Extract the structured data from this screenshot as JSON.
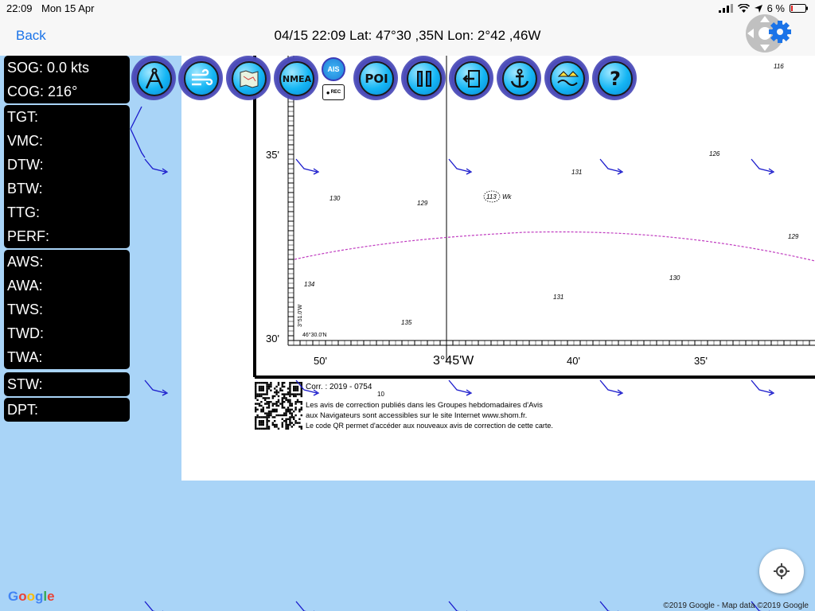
{
  "status_bar": {
    "time": "22:09",
    "date": "Mon 15 Apr",
    "battery": "6 %"
  },
  "nav": {
    "back_label": "Back",
    "title": "04/15 22:09  Lat: 47°30 ,35N Lon: 2°42 ,46W"
  },
  "panels": {
    "nav_group": [
      {
        "label": "SOG:",
        "value": "0.0 kts"
      },
      {
        "label": "COG:",
        "value": "216°"
      }
    ],
    "route_group": [
      {
        "label": "TGT:",
        "value": ""
      },
      {
        "label": "VMC:",
        "value": ""
      },
      {
        "label": "DTW:",
        "value": ""
      },
      {
        "label": "BTW:",
        "value": ""
      },
      {
        "label": "TTG:",
        "value": ""
      },
      {
        "label": "PERF:",
        "value": ""
      }
    ],
    "wind_group": [
      {
        "label": "AWS:",
        "value": ""
      },
      {
        "label": "AWA:",
        "value": ""
      },
      {
        "label": "TWS:",
        "value": ""
      },
      {
        "label": "TWD:",
        "value": ""
      },
      {
        "label": "TWA:",
        "value": ""
      }
    ],
    "stw_group": [
      {
        "label": "STW:",
        "value": ""
      }
    ],
    "dpt_group": [
      {
        "label": "DPT:",
        "value": ""
      }
    ]
  },
  "toolbar": {
    "nmea_label": "NMEA",
    "ais_label": "AIS",
    "rec_label": "REC",
    "poi_label": "POI",
    "help_label": "?"
  },
  "chart": {
    "lat_labels": {
      "top": "35'",
      "bottom": "30'"
    },
    "lon_labels": {
      "a": "50'",
      "b": "3°45'W",
      "c": "40'",
      "d": "35'"
    },
    "side_label": "3°51.0'W",
    "corner_label": "46°30.0'N",
    "soundings": [
      "116",
      "126",
      "131",
      "130",
      "129",
      "113",
      "Wk",
      "129",
      "134",
      "130",
      "131",
      "135"
    ],
    "corr_label": "Corr. :  2019 - 0754",
    "corr_sub": "10",
    "notice_1": "Les avis de correction publiés dans les Groupes hebdomadaires d'Avis",
    "notice_2": "aux Navigateurs sont accessibles sur le site Internet www.shom.fr.",
    "notice_3": "Le code QR permet d'accéder aux nouveaux avis de correction de cette carte."
  },
  "map_footer": {
    "logo": "Google",
    "attribution": "©2019 Google - Map data ©2019 Google"
  },
  "colors": {
    "accent": "#1a73e8",
    "panel_bg": "#000000",
    "water": "#a9d4f7",
    "wind_arrow": "#1a1acc",
    "depth_contour": "#c03cc0"
  }
}
